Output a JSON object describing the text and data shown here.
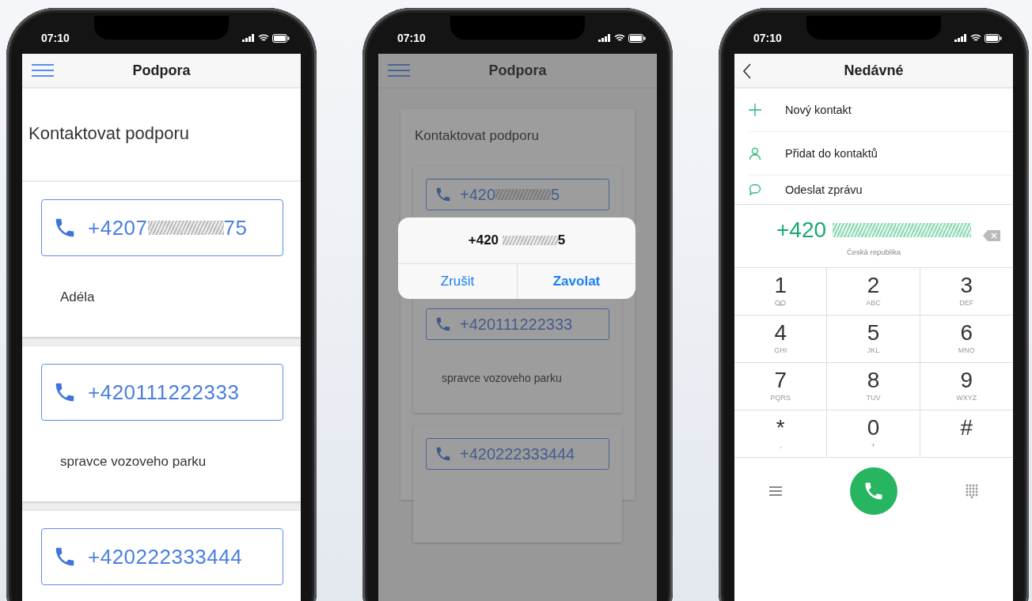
{
  "phones": [
    {
      "kind": "support",
      "time": "07:10",
      "header": {
        "title": "Podpora"
      },
      "page_title": "Kontaktovat podporu",
      "contacts": [
        {
          "number": "+4207",
          "number_tail": "75",
          "name": "Adéla"
        },
        {
          "number": "+420111222333",
          "name": "spravce vozoveho parku"
        },
        {
          "number": "+420222333444"
        }
      ]
    },
    {
      "kind": "support_dialog",
      "time": "07:10",
      "header": {
        "title": "Podpora"
      },
      "page_title": "Kontaktovat podporu",
      "contacts": [
        {
          "number": "+420",
          "number_tail": "5"
        },
        {
          "number": "+420111222333",
          "name": "spravce vozoveho parku"
        },
        {
          "number": "+420222333444"
        }
      ],
      "dialog": {
        "number": "+420",
        "number_tail": "5",
        "buttons": [
          {
            "label": "Zrušit",
            "kind": "cancel"
          },
          {
            "label": "Zavolat",
            "kind": "confirm"
          }
        ]
      }
    },
    {
      "kind": "dialer",
      "time": "07:10",
      "header": {
        "title": "Nedávné"
      },
      "actions": [
        {
          "kind": "plus",
          "label": "Nový kontakt"
        },
        {
          "kind": "person",
          "label": "Přidat do kontaktů"
        },
        {
          "kind": "bubble",
          "label": "Odeslat zprávu"
        }
      ],
      "number": "+420",
      "country": "Česká republika",
      "keys": [
        {
          "digit": "1",
          "kind": "voicemail"
        },
        {
          "digit": "2",
          "letters": "ABC"
        },
        {
          "digit": "3",
          "letters": "DEF"
        },
        {
          "digit": "4",
          "letters": "GHI"
        },
        {
          "digit": "5",
          "letters": "JKL"
        },
        {
          "digit": "6",
          "letters": "MNO"
        },
        {
          "digit": "7",
          "letters": "PQRS"
        },
        {
          "digit": "8",
          "letters": "TUV"
        },
        {
          "digit": "9",
          "letters": "WXYZ"
        },
        {
          "digit": "*",
          "letters": ","
        },
        {
          "digit": "0",
          "letters": "+"
        },
        {
          "digit": "#"
        }
      ]
    }
  ]
}
